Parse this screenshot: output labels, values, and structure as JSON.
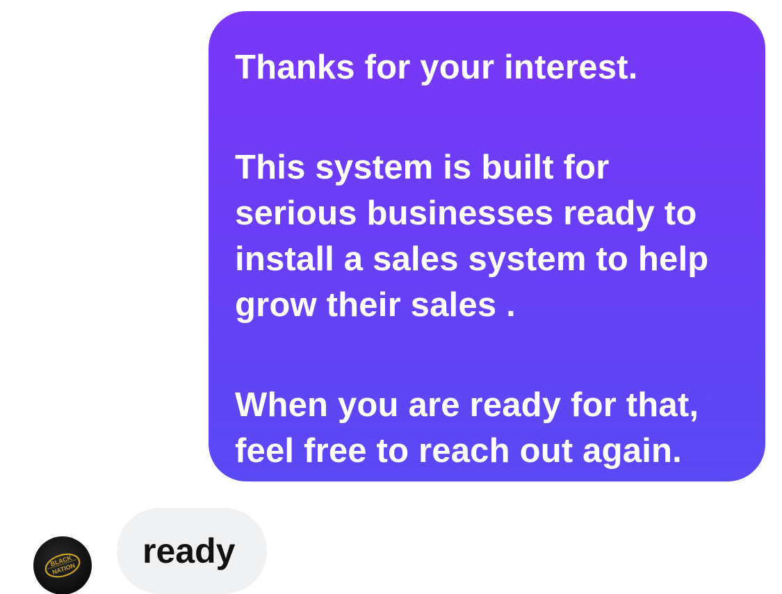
{
  "conversation": {
    "outgoing_message": {
      "paragraph_1": [
        "Thanks for your interest."
      ],
      "paragraph_2": [
        "This system is built for",
        "serious businesses ready to",
        "install a sales system to help",
        "grow their sales ."
      ],
      "paragraph_3": [
        "When you are ready for that,",
        "feel free to reach out again."
      ]
    },
    "incoming_message": {
      "text": "ready",
      "avatar_logo_text": [
        "BLACK",
        "NATION"
      ]
    }
  },
  "colors": {
    "outgoing_bubble_top": "#7a37f8",
    "outgoing_bubble_bottom": "#5a49f4",
    "incoming_bubble": "#f0f1f3",
    "avatar_logo": "#c9a227"
  },
  "icons": {
    "avatar": "black-nation-logo"
  }
}
